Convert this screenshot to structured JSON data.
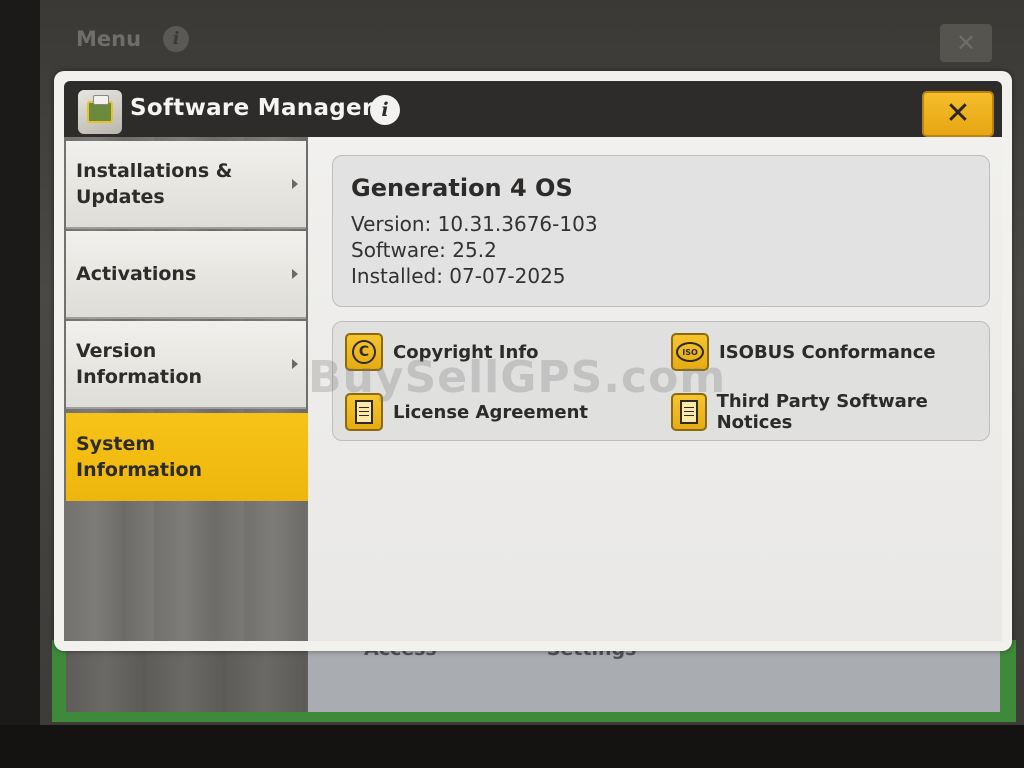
{
  "background_app": {
    "menu_label": "Menu",
    "bottom_labels": [
      "Access",
      "Settings"
    ]
  },
  "dialog": {
    "title": "Software Manager",
    "info_icon": "info-icon",
    "close_icon": "close-icon",
    "app_icon": "software-manager-icon"
  },
  "sidebar": {
    "items": [
      {
        "label": "Installations &\nUpdates",
        "active": false
      },
      {
        "label": "Activations",
        "active": false
      },
      {
        "label": "Version\nInformation",
        "active": false
      },
      {
        "label": "System\nInformation",
        "active": true
      }
    ]
  },
  "system_info": {
    "title": "Generation 4 OS",
    "version": "Version: 10.31.3676-103",
    "software": "Software: 25.2",
    "installed": "Installed: 07-07-2025"
  },
  "links": [
    {
      "label": "Copyright Info",
      "icon": "copyright-icon"
    },
    {
      "label": "ISOBUS Conformance",
      "icon": "iso-icon"
    },
    {
      "label": "License Agreement",
      "icon": "document-icon"
    },
    {
      "label": "Third Party Software Notices",
      "icon": "document-icon"
    }
  ],
  "watermark": "BuySellGPS.com",
  "colors": {
    "accent": "#f2b90e",
    "titlebar": "#2e2c2a",
    "panel": "#e2e2e2"
  }
}
